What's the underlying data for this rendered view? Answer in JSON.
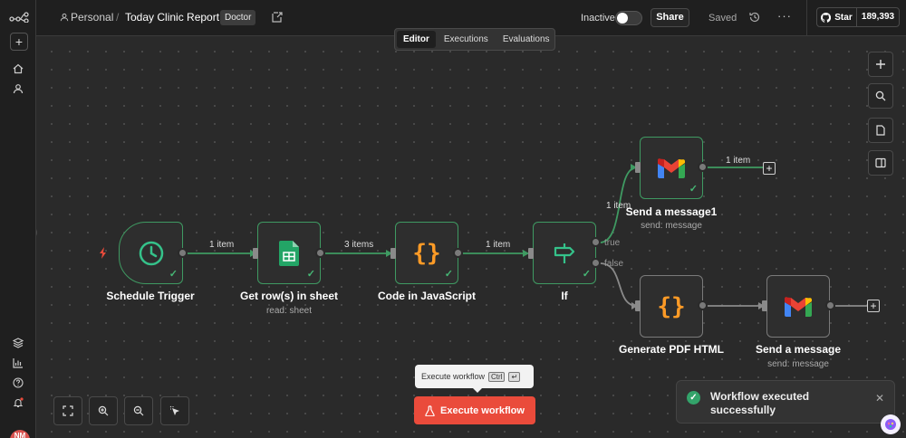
{
  "header": {
    "project": "Personal",
    "separator": "/",
    "workflow_name": "Today Clinic Report",
    "tag": "Doctor",
    "status_label": "Inactive",
    "share_label": "Share",
    "saved_label": "Saved",
    "more_label": "···",
    "github_star_label": "Star",
    "github_count": "189,393"
  },
  "tabs": [
    {
      "label": "Editor",
      "active": true
    },
    {
      "label": "Executions",
      "active": false
    },
    {
      "label": "Evaluations",
      "active": false
    }
  ],
  "nodes": {
    "schedule": {
      "label": "Schedule Trigger",
      "icon": "clock-icon"
    },
    "sheet": {
      "label": "Get row(s) in sheet",
      "sub": "read: sheet",
      "icon": "google-sheets-icon"
    },
    "code": {
      "label": "Code in JavaScript",
      "icon": "code-braces-icon"
    },
    "if": {
      "label": "If",
      "icon": "signpost-icon"
    },
    "gmail1": {
      "label": "Send a message1",
      "sub": "send: message",
      "icon": "gmail-icon"
    },
    "pdf": {
      "label": "Generate PDF HTML",
      "icon": "code-braces-icon"
    },
    "gmail2": {
      "label": "Send a message",
      "sub": "send: message",
      "icon": "gmail-icon"
    }
  },
  "edges": {
    "e1": "1 item",
    "e2": "3 items",
    "e3": "1 item",
    "e4": "1 item",
    "e5": "1 item",
    "true_label": "true",
    "false_label": "false"
  },
  "execute": {
    "tooltip_text": "Execute workflow",
    "shortcut_key": "Ctrl",
    "shortcut_enter": "↵",
    "button_label": "Execute workflow"
  },
  "toast": {
    "message": "Workflow executed successfully",
    "close": "✕"
  },
  "user": {
    "initials": "NM"
  },
  "colors": {
    "accent": "#ea4b3b",
    "success": "#3f9a62",
    "background": "#2a2a2a"
  }
}
